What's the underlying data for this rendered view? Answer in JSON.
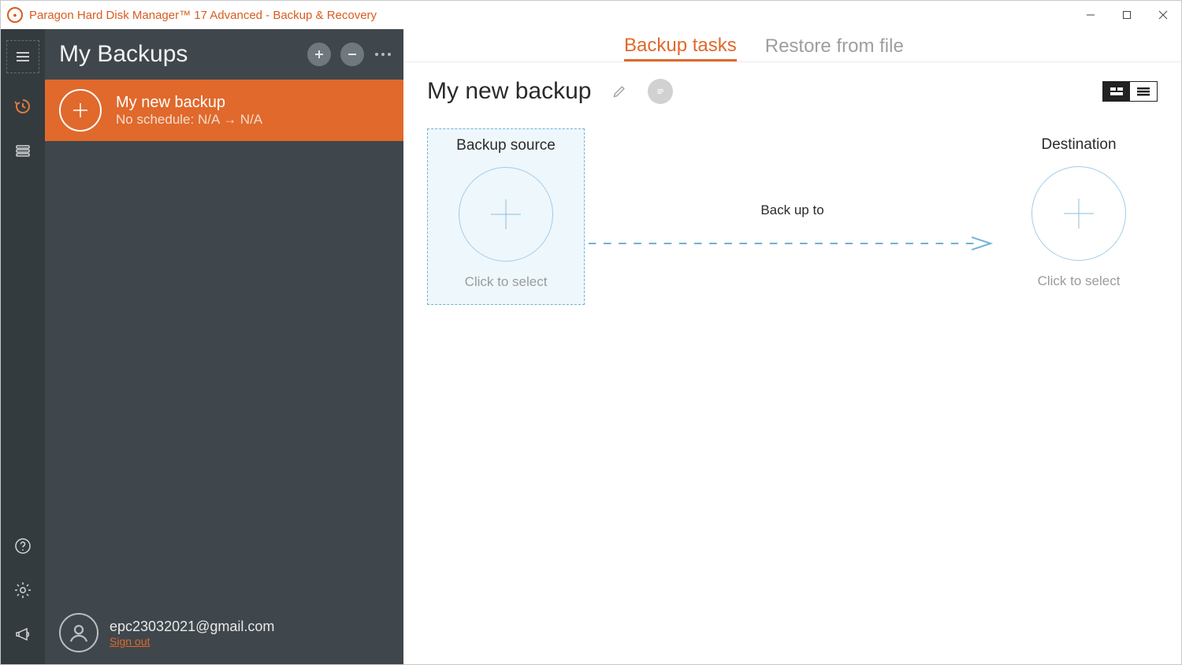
{
  "titlebar": {
    "title": "Paragon Hard Disk Manager™ 17 Advanced - Backup & Recovery"
  },
  "sidebar": {
    "title": "My Backups",
    "items": [
      {
        "name": "My new backup",
        "subtitle": "No schedule: N/A → N/A"
      }
    ]
  },
  "user": {
    "email": "epc23032021@gmail.com",
    "signout": "Sign out"
  },
  "tabs": {
    "backup": "Backup tasks",
    "restore": "Restore from file"
  },
  "content": {
    "title": "My new backup"
  },
  "source": {
    "title": "Backup source",
    "hint": "Click to select"
  },
  "arrow": {
    "label": "Back up to"
  },
  "dest": {
    "title": "Destination",
    "hint": "Click to select"
  }
}
